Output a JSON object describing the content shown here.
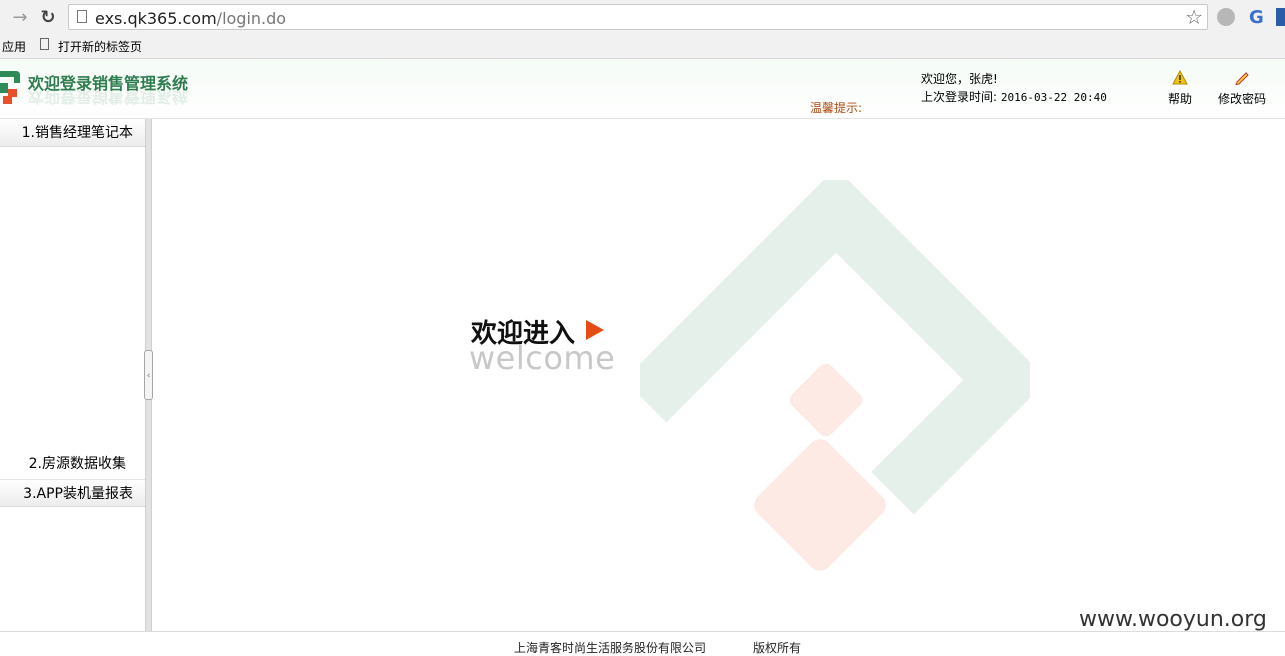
{
  "browser": {
    "url_host": "exs.qk365.com",
    "url_path": "/login.do",
    "bookmarks": {
      "apps": "应用",
      "new_tab": "打开新的标签页"
    }
  },
  "header": {
    "system_title": "欢迎登录销售管理系统",
    "tip_label": "温馨提示:",
    "welcome_user": "欢迎您，张虎!",
    "last_login_label": "上次登录时间:",
    "last_login_value": "2016-03-22 20:40",
    "help_label": "帮助",
    "change_password_label": "修改密码"
  },
  "sidebar": {
    "items": [
      {
        "label": "1.销售经理笔记本"
      },
      {
        "label": "2.房源数据收集"
      },
      {
        "label": "3.APP装机量报表"
      }
    ]
  },
  "main": {
    "welcome_cn": "欢迎进入",
    "welcome_en": "welcome"
  },
  "footer": {
    "company": "上海青客时尚生活服务股份有限公司",
    "rights": "版权所有"
  },
  "watermark": "www.wooyun.org",
  "colors": {
    "brand_green": "#2e7d4f",
    "accent_orange": "#e44c12",
    "tip_color": "#b24a11"
  }
}
